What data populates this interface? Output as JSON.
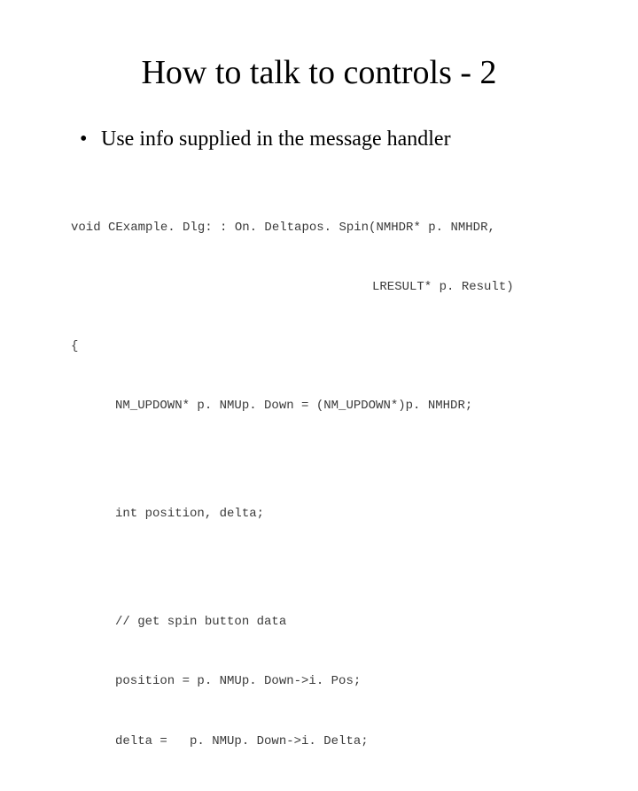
{
  "title": "How to talk to controls - 2",
  "bullet": {
    "items": [
      "Use info supplied in the message handler"
    ]
  },
  "code": {
    "line1": "void CExample. Dlg: : On. Deltapos. Spin(NMHDR* p. NMHDR,",
    "line2": "LRESULT* p. Result)",
    "line3": "{",
    "line4": "NM_UPDOWN* p. NMUp. Down = (NM_UPDOWN*)p. NMHDR;",
    "line5": "int position, delta;",
    "comment": "// get spin button data",
    "line6": "position = p. NMUp. Down->i. Pos;",
    "line7": "delta =   p. NMUp. Down->i. Delta;"
  }
}
